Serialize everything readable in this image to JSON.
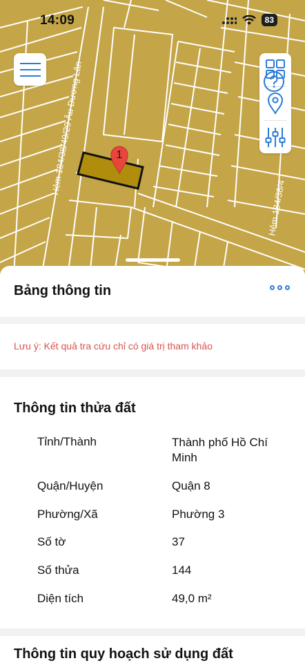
{
  "status_bar": {
    "time": "14:09",
    "battery": "83"
  },
  "map": {
    "marker_number": "1",
    "street_label_left": "Hẻm 184/38/49/29 Âu Dương Lân",
    "street_label_right": "Hẻm 184/38/4"
  },
  "header": {
    "title": "Bảng thông tin"
  },
  "note": {
    "text": "Lưu ý: Kết quả tra cứu chỉ có giá trị tham khảo"
  },
  "parcel": {
    "title": "Thông tin thửa đất",
    "rows": [
      {
        "label": "Tỉnh/Thành",
        "value": "Thành phố Hồ Chí Minh"
      },
      {
        "label": "Quận/Huyện",
        "value": "Quận 8"
      },
      {
        "label": "Phường/Xã",
        "value": "Phường 3"
      },
      {
        "label": "Số tờ",
        "value": "37"
      },
      {
        "label": "Số thửa",
        "value": "144"
      },
      {
        "label": "Diện tích",
        "value": "49,0 m²"
      }
    ]
  },
  "planning": {
    "title": "Thông tin quy hoạch sử dụng đất"
  },
  "colors": {
    "map_fill": "#c4a548",
    "parcel_fill": "#b08d0c",
    "accent": "#2a7bd6",
    "note": "#d9534f",
    "marker": "#e8463c"
  },
  "icons": [
    "hamburger-icon",
    "grid-icon",
    "location-pin-icon",
    "sliders-icon",
    "more-icon",
    "help-icon",
    "signal-icon",
    "wifi-icon"
  ]
}
